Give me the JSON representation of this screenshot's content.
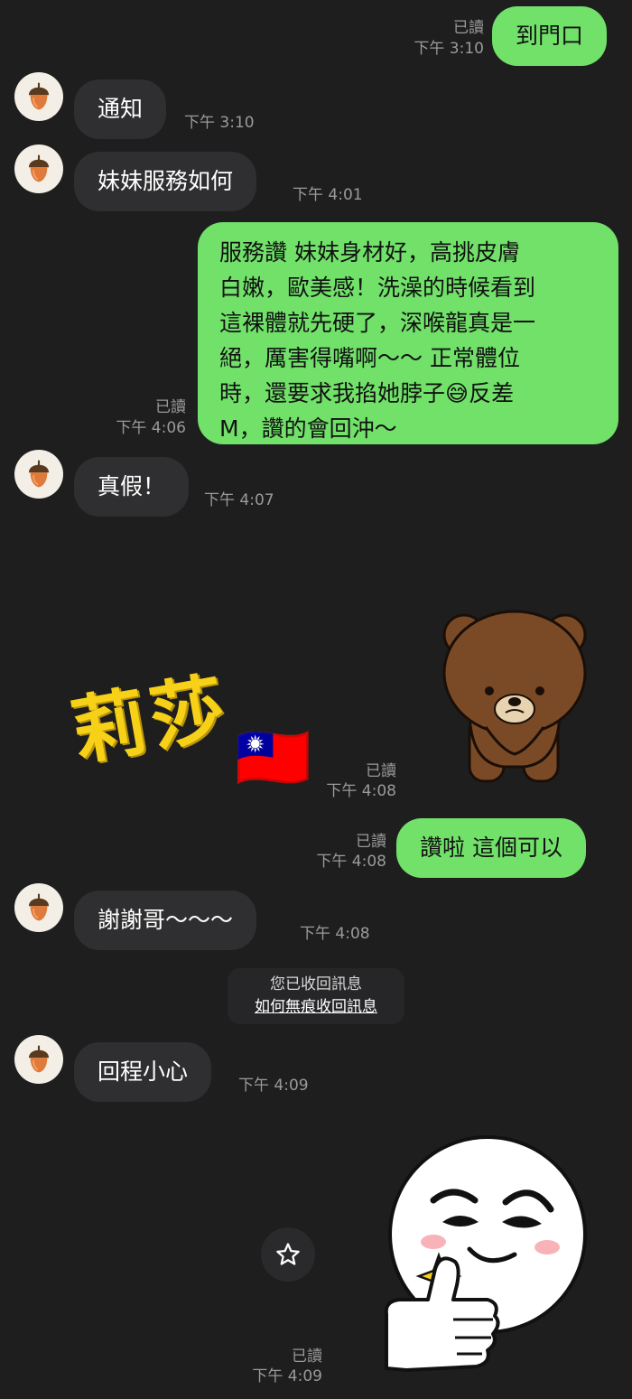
{
  "messages": [
    {
      "id": "m1",
      "side": "out",
      "text": "到門口",
      "read": "已讀",
      "time": "下午 3:10"
    },
    {
      "id": "m2",
      "side": "in",
      "text": "通知",
      "time": "下午 3:10",
      "avatar": "acorn-icon"
    },
    {
      "id": "m3",
      "side": "in",
      "text": "妹妹服務如何",
      "time": "下午 4:01",
      "avatar": "acorn-icon"
    },
    {
      "id": "m4",
      "side": "out",
      "lines": [
        "服務讚 妹妹身材好，高挑皮膚",
        "白嫩，歐美感！洗澡的時候看到",
        "這裸體就先硬了，深喉龍真是一",
        "絕，厲害得嘴啊～～ 正常體位",
        "時，還要求我掐她脖子😅反差",
        "M，讚的會回沖～"
      ],
      "read": "已讀",
      "time": "下午 4:06"
    },
    {
      "id": "m5",
      "side": "in",
      "text": "真假！",
      "time": "下午 4:07",
      "avatar": "acorn-icon"
    },
    {
      "id": "m6",
      "side": "out",
      "type": "sticker",
      "sticker_text": "莉莎",
      "sticker_emoji": "🇹🇼",
      "sticker_character": "brown-bear-sticker",
      "read": "已讀",
      "time": "下午 4:08"
    },
    {
      "id": "m7",
      "side": "out",
      "text": "讚啦 這個可以",
      "read": "已讀",
      "time": "下午 4:08"
    },
    {
      "id": "m8",
      "side": "in",
      "text": "謝謝哥～～～",
      "time": "下午 4:08",
      "avatar": "acorn-icon"
    },
    {
      "id": "m9",
      "side": "in",
      "text": "回程小心",
      "time": "下午 4:09",
      "avatar": "acorn-icon"
    },
    {
      "id": "m10",
      "side": "out",
      "type": "sticker",
      "sticker_character": "moon-thumbs-up-sticker",
      "read": "已讀",
      "time": "下午 4:09"
    }
  ],
  "system": {
    "unsent_notice": "您已收回訊息",
    "unsent_link": "如何無痕收回訊息"
  },
  "controls": {
    "favorite_icon": "star-icon"
  },
  "colors": {
    "background": "#1e1e1e",
    "incoming_bubble": "#2f2f31",
    "outgoing_bubble": "#71e16a",
    "meta_text": "#9a9a9a"
  }
}
